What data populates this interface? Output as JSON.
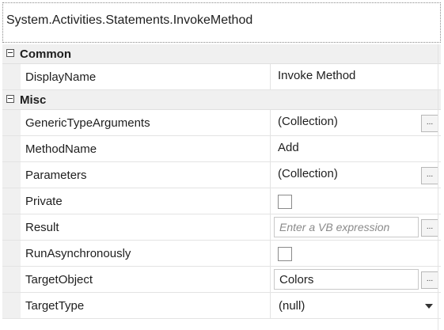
{
  "header": {
    "title": "System.Activities.Statements.InvokeMethod"
  },
  "categories": {
    "common": {
      "label": "Common"
    },
    "misc": {
      "label": "Misc"
    }
  },
  "properties": {
    "display_name": {
      "name": "DisplayName",
      "value": "Invoke Method"
    },
    "generic_type_arguments": {
      "name": "GenericTypeArguments",
      "value": "(Collection)",
      "button": "..."
    },
    "method_name": {
      "name": "MethodName",
      "value": "Add"
    },
    "parameters": {
      "name": "Parameters",
      "value": "(Collection)",
      "button": "..."
    },
    "private": {
      "name": "Private",
      "checked": false
    },
    "result": {
      "name": "Result",
      "placeholder": "Enter a VB expression",
      "button": "..."
    },
    "run_asynchronously": {
      "name": "RunAsynchronously",
      "checked": false
    },
    "target_object": {
      "name": "TargetObject",
      "value": "Colors",
      "button": "..."
    },
    "target_type": {
      "name": "TargetType",
      "value": "(null)"
    }
  },
  "icons": {
    "collapse": "minus-box-icon",
    "dropdown": "chevron-down-icon"
  }
}
